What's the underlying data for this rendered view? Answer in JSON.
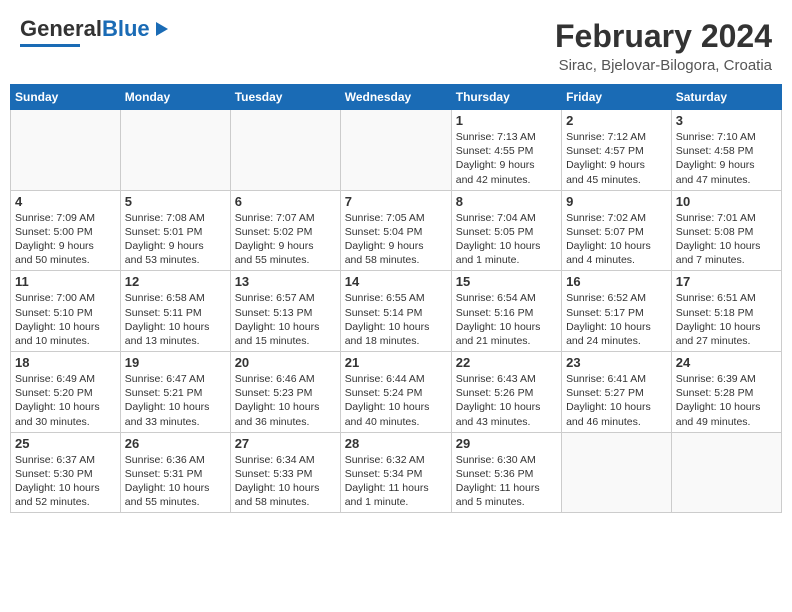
{
  "header": {
    "logo_general": "General",
    "logo_blue": "Blue",
    "month": "February 2024",
    "location": "Sirac, Bjelovar-Bilogora, Croatia"
  },
  "days_of_week": [
    "Sunday",
    "Monday",
    "Tuesday",
    "Wednesday",
    "Thursday",
    "Friday",
    "Saturday"
  ],
  "weeks": [
    [
      {
        "day": "",
        "info": ""
      },
      {
        "day": "",
        "info": ""
      },
      {
        "day": "",
        "info": ""
      },
      {
        "day": "",
        "info": ""
      },
      {
        "day": "1",
        "info": "Sunrise: 7:13 AM\nSunset: 4:55 PM\nDaylight: 9 hours\nand 42 minutes."
      },
      {
        "day": "2",
        "info": "Sunrise: 7:12 AM\nSunset: 4:57 PM\nDaylight: 9 hours\nand 45 minutes."
      },
      {
        "day": "3",
        "info": "Sunrise: 7:10 AM\nSunset: 4:58 PM\nDaylight: 9 hours\nand 47 minutes."
      }
    ],
    [
      {
        "day": "4",
        "info": "Sunrise: 7:09 AM\nSunset: 5:00 PM\nDaylight: 9 hours\nand 50 minutes."
      },
      {
        "day": "5",
        "info": "Sunrise: 7:08 AM\nSunset: 5:01 PM\nDaylight: 9 hours\nand 53 minutes."
      },
      {
        "day": "6",
        "info": "Sunrise: 7:07 AM\nSunset: 5:02 PM\nDaylight: 9 hours\nand 55 minutes."
      },
      {
        "day": "7",
        "info": "Sunrise: 7:05 AM\nSunset: 5:04 PM\nDaylight: 9 hours\nand 58 minutes."
      },
      {
        "day": "8",
        "info": "Sunrise: 7:04 AM\nSunset: 5:05 PM\nDaylight: 10 hours\nand 1 minute."
      },
      {
        "day": "9",
        "info": "Sunrise: 7:02 AM\nSunset: 5:07 PM\nDaylight: 10 hours\nand 4 minutes."
      },
      {
        "day": "10",
        "info": "Sunrise: 7:01 AM\nSunset: 5:08 PM\nDaylight: 10 hours\nand 7 minutes."
      }
    ],
    [
      {
        "day": "11",
        "info": "Sunrise: 7:00 AM\nSunset: 5:10 PM\nDaylight: 10 hours\nand 10 minutes."
      },
      {
        "day": "12",
        "info": "Sunrise: 6:58 AM\nSunset: 5:11 PM\nDaylight: 10 hours\nand 13 minutes."
      },
      {
        "day": "13",
        "info": "Sunrise: 6:57 AM\nSunset: 5:13 PM\nDaylight: 10 hours\nand 15 minutes."
      },
      {
        "day": "14",
        "info": "Sunrise: 6:55 AM\nSunset: 5:14 PM\nDaylight: 10 hours\nand 18 minutes."
      },
      {
        "day": "15",
        "info": "Sunrise: 6:54 AM\nSunset: 5:16 PM\nDaylight: 10 hours\nand 21 minutes."
      },
      {
        "day": "16",
        "info": "Sunrise: 6:52 AM\nSunset: 5:17 PM\nDaylight: 10 hours\nand 24 minutes."
      },
      {
        "day": "17",
        "info": "Sunrise: 6:51 AM\nSunset: 5:18 PM\nDaylight: 10 hours\nand 27 minutes."
      }
    ],
    [
      {
        "day": "18",
        "info": "Sunrise: 6:49 AM\nSunset: 5:20 PM\nDaylight: 10 hours\nand 30 minutes."
      },
      {
        "day": "19",
        "info": "Sunrise: 6:47 AM\nSunset: 5:21 PM\nDaylight: 10 hours\nand 33 minutes."
      },
      {
        "day": "20",
        "info": "Sunrise: 6:46 AM\nSunset: 5:23 PM\nDaylight: 10 hours\nand 36 minutes."
      },
      {
        "day": "21",
        "info": "Sunrise: 6:44 AM\nSunset: 5:24 PM\nDaylight: 10 hours\nand 40 minutes."
      },
      {
        "day": "22",
        "info": "Sunrise: 6:43 AM\nSunset: 5:26 PM\nDaylight: 10 hours\nand 43 minutes."
      },
      {
        "day": "23",
        "info": "Sunrise: 6:41 AM\nSunset: 5:27 PM\nDaylight: 10 hours\nand 46 minutes."
      },
      {
        "day": "24",
        "info": "Sunrise: 6:39 AM\nSunset: 5:28 PM\nDaylight: 10 hours\nand 49 minutes."
      }
    ],
    [
      {
        "day": "25",
        "info": "Sunrise: 6:37 AM\nSunset: 5:30 PM\nDaylight: 10 hours\nand 52 minutes."
      },
      {
        "day": "26",
        "info": "Sunrise: 6:36 AM\nSunset: 5:31 PM\nDaylight: 10 hours\nand 55 minutes."
      },
      {
        "day": "27",
        "info": "Sunrise: 6:34 AM\nSunset: 5:33 PM\nDaylight: 10 hours\nand 58 minutes."
      },
      {
        "day": "28",
        "info": "Sunrise: 6:32 AM\nSunset: 5:34 PM\nDaylight: 11 hours\nand 1 minute."
      },
      {
        "day": "29",
        "info": "Sunrise: 6:30 AM\nSunset: 5:36 PM\nDaylight: 11 hours\nand 5 minutes."
      },
      {
        "day": "",
        "info": ""
      },
      {
        "day": "",
        "info": ""
      }
    ]
  ]
}
